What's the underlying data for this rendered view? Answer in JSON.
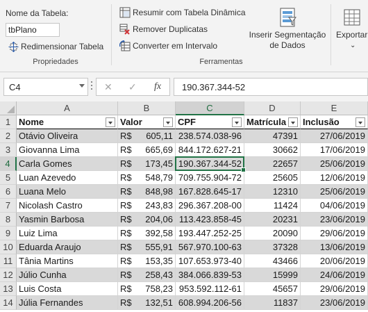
{
  "ribbon": {
    "table_name_label": "Nome da Tabela:",
    "table_name_value": "tbPlano",
    "resize_table": "Redimensionar Tabela",
    "group_properties": "Propriedades",
    "summarize_pivot": "Resumir com Tabela Dinâmica",
    "remove_duplicates": "Remover Duplicatas",
    "convert_to_range": "Converter em Intervalo",
    "group_tools": "Ferramentas",
    "insert_slicer_line1": "Inserir Segmentação",
    "insert_slicer_line2": "de Dados",
    "export": "Exportar"
  },
  "formula_bar": {
    "name_box": "C4",
    "cancel_glyph": "✕",
    "enter_glyph": "✓",
    "fx_glyph": "fx",
    "formula": "190.367.344-52"
  },
  "sheet": {
    "columns": [
      "A",
      "B",
      "C",
      "D",
      "E"
    ],
    "selected_column": "C",
    "selected_row": 4,
    "rows": [
      "1",
      "2",
      "3",
      "4",
      "5",
      "6",
      "7",
      "8",
      "9",
      "10",
      "11",
      "12",
      "13",
      "14"
    ],
    "headers": [
      "Nome",
      "Valor",
      "CPF",
      "Matrícula",
      "Inclusão"
    ],
    "currency": "R$",
    "data": [
      [
        "Otávio Oliveira",
        "605,11",
        "238.574.038-96",
        "47391",
        "27/06/2019"
      ],
      [
        "Giovanna Lima",
        "665,69",
        "844.172.627-21",
        "30662",
        "17/06/2019"
      ],
      [
        "Carla Gomes",
        "173,45",
        "190.367.344-52",
        "22657",
        "25/06/2019"
      ],
      [
        "Luan Azevedo",
        "548,79",
        "709.755.904-72",
        "25605",
        "12/06/2019"
      ],
      [
        "Luana Melo",
        "848,98",
        "167.828.645-17",
        "12310",
        "25/06/2019"
      ],
      [
        "Nicolash Castro",
        "243,83",
        "296.367.208-00",
        "11424",
        "04/06/2019"
      ],
      [
        "Yasmin Barbosa",
        "204,06",
        "113.423.858-45",
        "20231",
        "23/06/2019"
      ],
      [
        "Luiz Lima",
        "392,58",
        "193.447.252-25",
        "20090",
        "29/06/2019"
      ],
      [
        "Eduarda Araujo",
        "555,91",
        "567.970.100-63",
        "37328",
        "13/06/2019"
      ],
      [
        "Tânia Martins",
        "153,35",
        "107.653.973-40",
        "43466",
        "20/06/2019"
      ],
      [
        "Júlio Cunha",
        "258,43",
        "384.066.839-53",
        "15999",
        "24/06/2019"
      ],
      [
        "Luis Costa",
        "758,23",
        "953.592.112-61",
        "45657",
        "29/06/2019"
      ],
      [
        "Júlia Fernandes",
        "132,51",
        "608.994.206-56",
        "11837",
        "23/06/2019"
      ]
    ]
  }
}
